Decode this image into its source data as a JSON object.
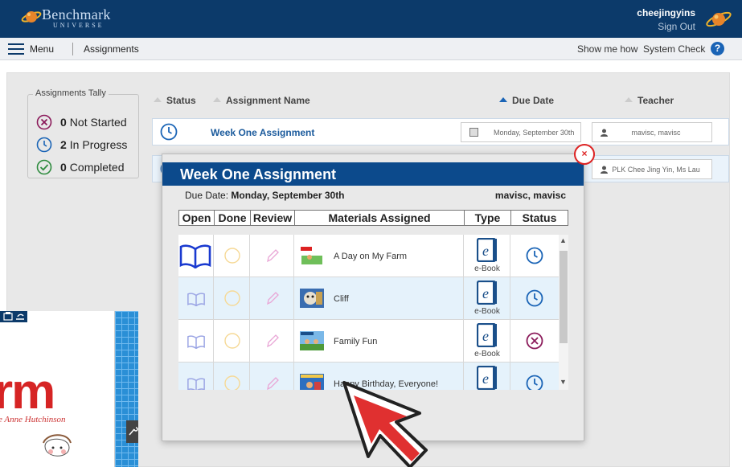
{
  "header": {
    "logo_line1": "Benchmark",
    "logo_line2": "UNIVERSE",
    "username": "cheejingyins",
    "sign_out": "Sign Out"
  },
  "nav": {
    "menu": "Menu",
    "assignments": "Assignments",
    "show_me_how": "Show me how",
    "system_check": "System Check",
    "help": "?"
  },
  "tally": {
    "title": "Assignments Tally",
    "items": [
      {
        "count": "0",
        "label": "Not Started",
        "color": "#8b1a5a"
      },
      {
        "count": "2",
        "label": "In Progress",
        "color": "#1a64b6"
      },
      {
        "count": "0",
        "label": "Completed",
        "color": "#2e8b3e"
      }
    ]
  },
  "list": {
    "headers": {
      "status": "Status",
      "name": "Assignment Name",
      "due": "Due Date",
      "teacher": "Teacher"
    },
    "rows": [
      {
        "name": "Week One Assignment",
        "due": "Monday, September 30th",
        "teacher": "mavisc, mavisc"
      },
      {
        "name": "",
        "due": "",
        "teacher": "PLK Chee Jing Yin, Ms Lau"
      }
    ]
  },
  "modal": {
    "title": "Week One Assignment",
    "due_label": "Due Date:",
    "due_value": "Monday, September 30th",
    "teacher": "mavisc, mavisc",
    "close": "×",
    "columns": [
      "Open",
      "Done",
      "Review",
      "Materials Assigned",
      "Type",
      "Status"
    ],
    "materials": [
      {
        "name": "A Day on My Farm",
        "type": "e-Book",
        "status": "in-progress"
      },
      {
        "name": "Cliff",
        "type": "e-Book",
        "status": "in-progress"
      },
      {
        "name": "Family Fun",
        "type": "e-Book",
        "status": "not-started"
      },
      {
        "name": "Happy Birthday, Everyone!",
        "type": "e-Book",
        "status": "in-progress"
      }
    ]
  },
  "preview": {
    "title_fragment": "rm",
    "author_fragment": "e Anne Hutchinson"
  },
  "colors": {
    "brand": "#0c3a6a",
    "accent": "#1a64b6",
    "row_alt": "#e5f2fb",
    "close": "#dd2222"
  }
}
